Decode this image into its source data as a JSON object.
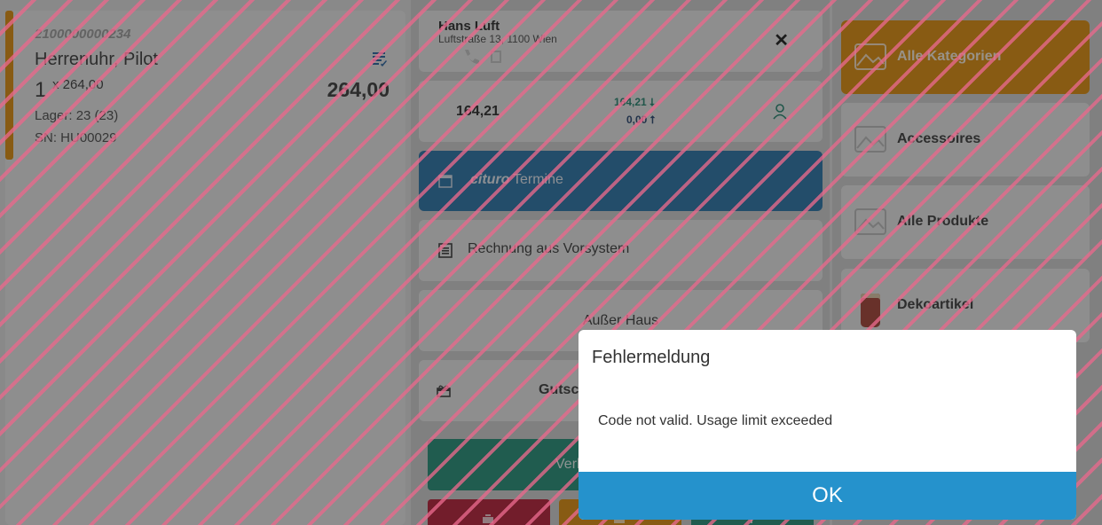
{
  "item": {
    "code": "2100000000234",
    "name": "Herrenuhr, Pilot",
    "quantity": "1",
    "unit_price": "x 264,00",
    "total": "264,00",
    "stock": "Lager: 23 (23)",
    "serial": "SN: HU00029",
    "icon": "note-icon"
  },
  "customer": {
    "name": "Hans Luft",
    "address": "Luftstraße 13, 1100 Wien",
    "close_icon": "close-icon",
    "close_glyph": "✕"
  },
  "balance": {
    "value": "164,21",
    "incoming": "164,21 ⭣",
    "outgoing": "0,00 ⭡",
    "icon": "person-icon"
  },
  "termine": {
    "brand": "cituro",
    "label": "Termine",
    "icon": "calendar-icon"
  },
  "rechnung": {
    "label": "Rechnung aus Vorsystem",
    "icon": "document-icon"
  },
  "ausser_haus": {
    "label": "Außer Haus"
  },
  "gutschein": {
    "label": "Gutsch",
    "icon": "gift-icon"
  },
  "sell": {
    "label": "Verk"
  },
  "categories": [
    {
      "label": "Alle Kategorien",
      "icon": "image-icon",
      "active": true
    },
    {
      "label": "Accessoires",
      "icon": "image-icon"
    },
    {
      "label": "Alle Produkte",
      "icon": "image-icon"
    },
    {
      "label": "Dekoartikel",
      "icon": "candle-thumbnail"
    }
  ],
  "dialog": {
    "title": "Fehlermeldung",
    "message": "Code not valid. Usage limit exceeded",
    "ok_label": "OK"
  },
  "colors": {
    "accent_orange": "#e08a00",
    "termine_blue": "#1f6fa8",
    "sell_green": "#1a8c74",
    "danger_red": "#b6142e",
    "ok_blue": "#2592cc",
    "stripe_pink": "#e8698c"
  }
}
